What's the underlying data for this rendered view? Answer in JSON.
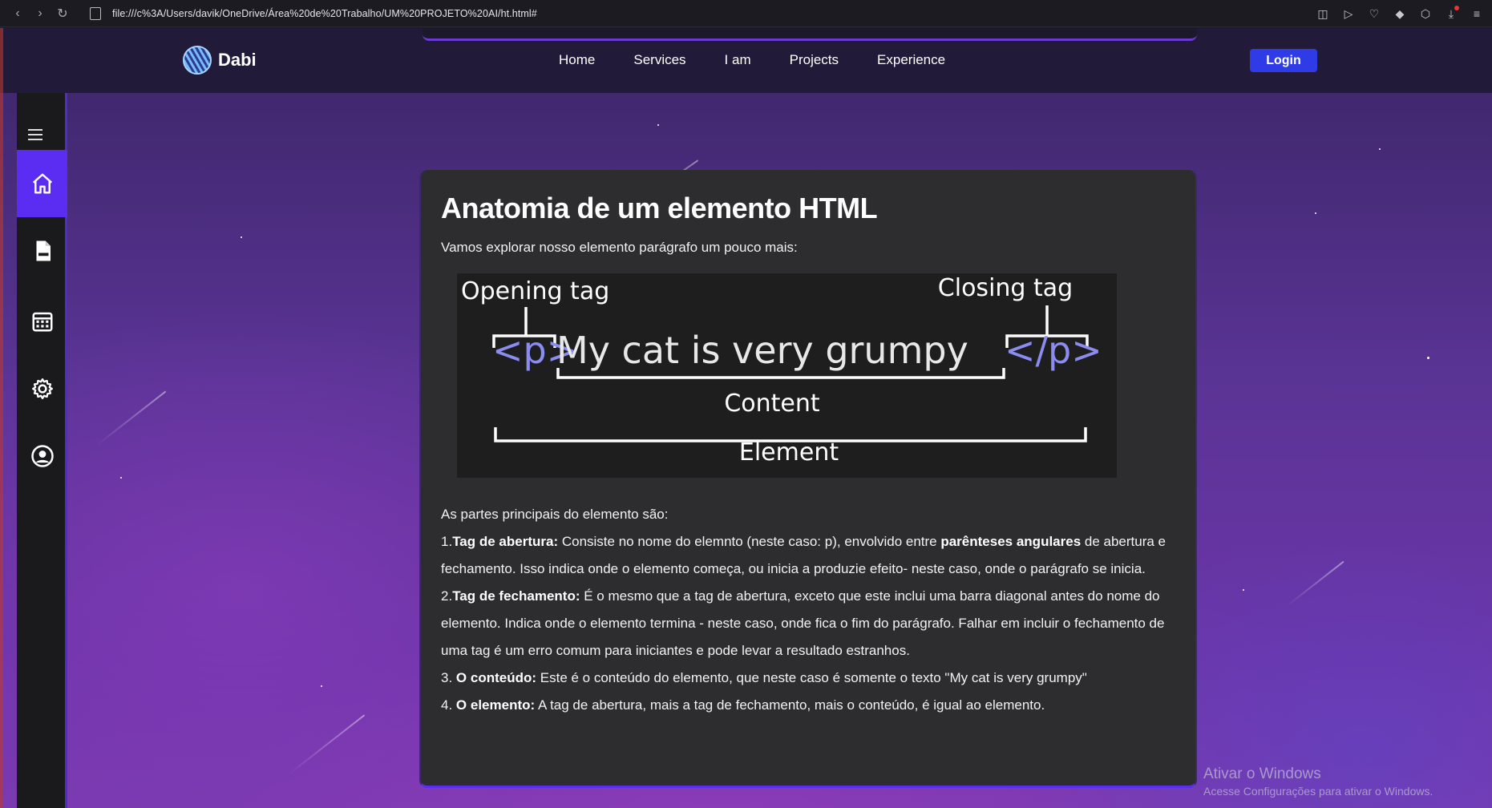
{
  "browser": {
    "address": "file:///c%3A/Users/davik/OneDrive/Área%20de%20Trabalho/UM%20PROJETO%20AI/ht.html#"
  },
  "navbar": {
    "brand": "Dabi",
    "menu": [
      "Home",
      "Services",
      "I am",
      "Projects",
      "Experience"
    ],
    "login": "Login"
  },
  "sidebar": {
    "items": [
      "home-icon",
      "html-file-icon",
      "calendar-icon",
      "gear-icon",
      "user-icon"
    ],
    "active": "home-icon"
  },
  "card": {
    "title": "Anatomia de um elemento HTML",
    "intro": "Vamos explorar nosso elemento parágrafo um pouco mais:",
    "diagram": {
      "opening_tag": "Opening tag",
      "closing_tag": "Closing tag",
      "open_code": "<p>",
      "content_code": "My cat is very grumpy",
      "close_code": "</p>",
      "content_label": "Content",
      "element_label": "Element"
    },
    "parts_heading": "As partes principais do elemento são:",
    "p1_num": "1.",
    "p1_bold": "Tag de abertura:",
    "p1_text": " Consiste no nome do elemnto (neste caso: p), envolvido entre ",
    "p1_bold2": "parênteses angulares",
    "p1_text2": " de abertura e fechamento. Isso indica onde o elemento começa, ou inicia a produzie efeito- neste caso, onde o parágrafo se inicia.",
    "p2_num": "2.",
    "p2_bold": "Tag de fechamento:",
    "p2_text": " É o mesmo que a tag de abertura, exceto que este inclui uma barra diagonal antes do nome do elemento. Indica onde o elemento termina - neste caso, onde fica o fim do parágrafo. Falhar em incluir o fechamento de uma tag é um erro comum para iniciantes e pode levar a resultado estranhos.",
    "p3_num": "3.",
    "p3_bold": "O conteúdo:",
    "p3_text": " Este é o conteúdo do elemento, que neste caso é somente o texto \"My cat is very grumpy\"",
    "p4_num": "4.",
    "p4_bold": "O elemento:",
    "p4_text": " A tag de abertura, mais a tag de fechamento, mais o conteúdo, é igual ao elemento."
  },
  "watermark": {
    "line1": "Ativar o Windows",
    "line2": "Acesse Configurações para ativar o Windows."
  },
  "colors": {
    "accent": "#5b2cf2",
    "login": "#2e3be6",
    "tag_code": "#8a8cf0"
  }
}
